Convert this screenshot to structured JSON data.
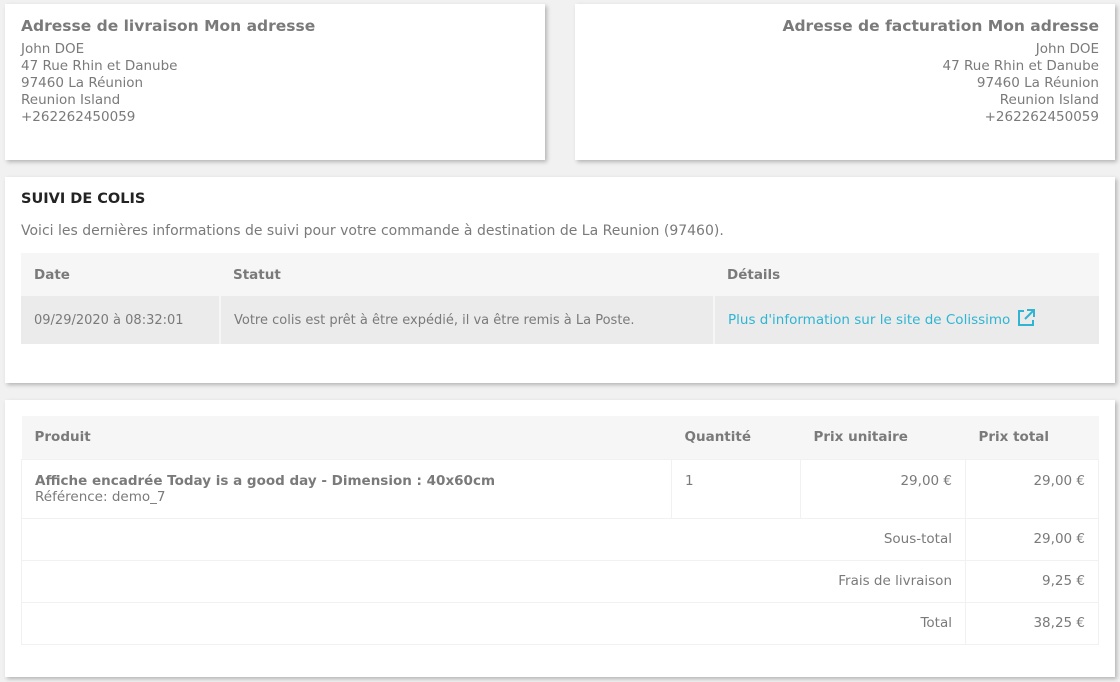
{
  "shipping": {
    "title": "Adresse de livraison Mon adresse",
    "lines": [
      "John DOE",
      "47 Rue Rhin et Danube",
      "97460 La Réunion",
      "Reunion Island",
      "+262262450059"
    ]
  },
  "billing": {
    "title": "Adresse de facturation Mon adresse",
    "lines": [
      "John DOE",
      "47 Rue Rhin et Danube",
      "97460 La Réunion",
      "Reunion Island",
      "+262262450059"
    ]
  },
  "tracking": {
    "title": "SUIVI DE COLIS",
    "intro": "Voici les dernières informations de suivi pour votre commande à destination de La Reunion (97460).",
    "headers": {
      "date": "Date",
      "status": "Statut",
      "details": "Détails"
    },
    "row": {
      "date": "09/29/2020 à 08:32:01",
      "status": "Votre colis est prêt à être expédié, il va être remis à La Poste.",
      "link": "Plus d'information sur le site de Colissimo"
    },
    "link_icon": "external-link-icon",
    "link_color": "#2fb5d2"
  },
  "order": {
    "headers": {
      "product": "Produit",
      "quantity": "Quantité",
      "unit_price": "Prix unitaire",
      "total_price": "Prix total"
    },
    "product": {
      "name": "Affiche encadrée Today is a good day - Dimension : 40x60cm",
      "reference": "Référence: demo_7",
      "quantity": "1",
      "unit_price": "29,00 €",
      "total_price": "29,00 €"
    },
    "subtotal": {
      "label": "Sous-total",
      "value": "29,00 €"
    },
    "shipping": {
      "label": "Frais de livraison",
      "value": "9,25 €"
    },
    "total": {
      "label": "Total",
      "value": "38,25 €"
    }
  }
}
